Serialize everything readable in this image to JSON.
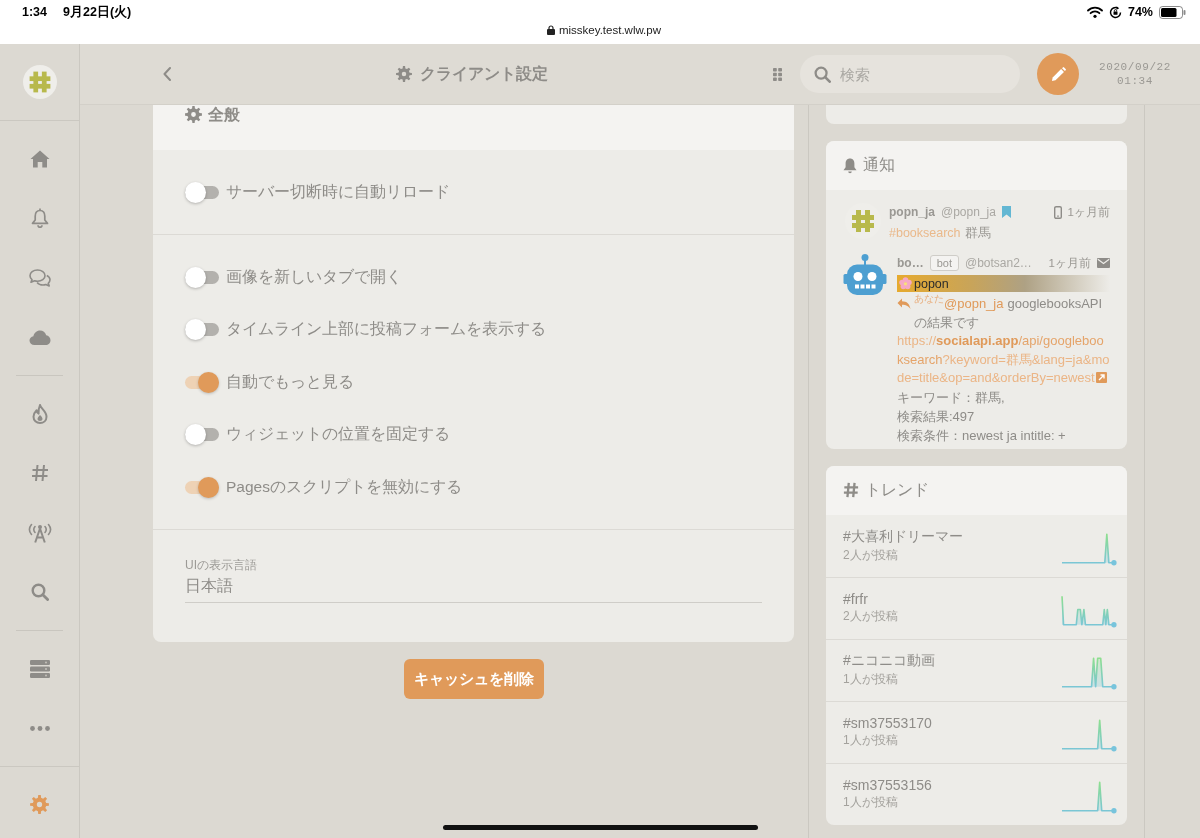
{
  "status_bar": {
    "time": "1:34",
    "date": "9月22日(火)",
    "url": "misskey.test.wlw.pw",
    "battery": "74%"
  },
  "sidebar": {
    "groups": [
      {
        "items": [
          {
            "kind": "home",
            "selected": false
          },
          {
            "kind": "notifications",
            "selected": false
          },
          {
            "kind": "messages",
            "selected": false
          },
          {
            "kind": "drive",
            "selected": false
          }
        ]
      },
      {
        "items": [
          {
            "kind": "featured",
            "selected": false
          },
          {
            "kind": "hashtags",
            "selected": false
          },
          {
            "kind": "antenna",
            "selected": false
          },
          {
            "kind": "search",
            "selected": false
          }
        ]
      },
      {
        "items": [
          {
            "kind": "instance",
            "selected": false
          },
          {
            "kind": "more",
            "selected": false
          }
        ]
      }
    ],
    "footer_items": [
      {
        "kind": "settings",
        "selected": true
      }
    ]
  },
  "header": {
    "title": "クライアント設定",
    "search": {
      "placeholder": "検索"
    },
    "clock": {
      "date": "2020/09/22",
      "time": "01:34"
    }
  },
  "settings_card": {
    "title": "全般",
    "sections": [
      {
        "kind": "toggles",
        "items": [
          {
            "label": "サーバー切断時に自動リロード",
            "on": false
          }
        ]
      },
      {
        "kind": "toggles",
        "items": [
          {
            "label": "画像を新しいタブで開く",
            "on": false
          },
          {
            "label": "タイムライン上部に投稿フォームを表示する",
            "on": false
          },
          {
            "label": "自動でもっと見る",
            "on": true
          },
          {
            "label": "ウィジェットの位置を固定する",
            "on": false
          },
          {
            "label": "Pagesのスクリプトを無効にする",
            "on": true
          }
        ]
      },
      {
        "kind": "select",
        "label": "UIの表示言語",
        "value": "日本語"
      }
    ]
  },
  "clear_cache_button": "キャッシュを削除",
  "notifications": {
    "title": "通知",
    "items": [
      {
        "kind": "note",
        "name": "popn_ja",
        "handle": "@popn_ja",
        "time": "1ヶ月前",
        "body": [
          {
            "kind": "hashtag",
            "text": "#booksearch"
          },
          {
            "kind": "plain",
            "text": "群馬"
          }
        ]
      },
      {
        "kind": "reply",
        "name": "bo…",
        "badge": "bot",
        "handle": "@botsan2…",
        "time": "1ヶ月前",
        "banner": "popon",
        "mention_label": "あなた",
        "mention": "@popn_ja",
        "text": "googlebooksAPIの結果です",
        "url": {
          "scheme": "https://",
          "host": "socialapi.app",
          "path": "/api/googlebooksearch",
          "query": "?keyword=群馬&lang=ja&mode=title&op=and&orderBy=newest"
        },
        "lines": [
          "キーワード：群馬,",
          "検索結果:497",
          "検索条件：newest ja intitle: +"
        ]
      }
    ]
  },
  "trends": {
    "title": "トレンド",
    "items": [
      {
        "tag": "#大喜利ドリーマー",
        "count": "2人が投稿"
      },
      {
        "tag": "#frfr",
        "count": "2人が投稿"
      },
      {
        "tag": "#ニコニコ動画",
        "count": "1人が投稿"
      },
      {
        "tag": "#sm37553170",
        "count": "1人が投稿"
      },
      {
        "tag": "#sm37553156",
        "count": "1人が投稿"
      }
    ]
  }
}
